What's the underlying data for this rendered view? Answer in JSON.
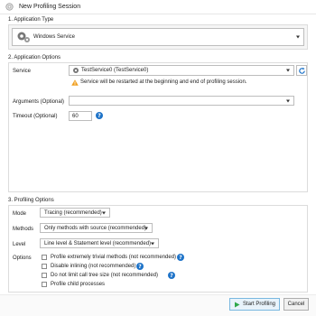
{
  "window": {
    "title": "New Profiling Session"
  },
  "app_type": {
    "section_title": "1. Application Type",
    "selected": "Windows Service"
  },
  "app_options": {
    "section_title": "2. Application Options",
    "service_label": "Service",
    "service_value": "TestService0 (TestService0)",
    "warning_text": "Service will be restarted at the beginning and end of profiling session.",
    "arguments_label": "Arguments (Optional)",
    "arguments_value": "",
    "timeout_label": "Timeout (Optional)",
    "timeout_value": "60"
  },
  "profiling_options": {
    "section_title": "3. Profiling Options",
    "mode_label": "Mode",
    "mode_value": "Tracing (recommended)",
    "methods_label": "Methods",
    "methods_value": "Only methods with source (recommended)",
    "level_label": "Level",
    "level_value": "Line level & Statement level (recommended)",
    "options_label": "Options",
    "checkboxes": [
      {
        "label": "Profile extremely trivial methods (not recommended)",
        "checked": false
      },
      {
        "label": "Disable inlining (not recommended)",
        "checked": false
      },
      {
        "label": "Do not limit call tree size (not recommended)",
        "checked": false
      },
      {
        "label": "Profile child processes",
        "checked": false
      }
    ]
  },
  "buttons": {
    "start": "Start Profiling",
    "cancel": "Cancel"
  },
  "colors": {
    "help": "#1e73c8",
    "warning": "#f0a020",
    "start_icon": "#2ea84a",
    "refresh": "#1e73c8"
  },
  "icons": {
    "app": "gear-icon",
    "service": "gear-icon",
    "warning": "warning-icon",
    "refresh": "refresh-icon",
    "start": "play-icon"
  }
}
